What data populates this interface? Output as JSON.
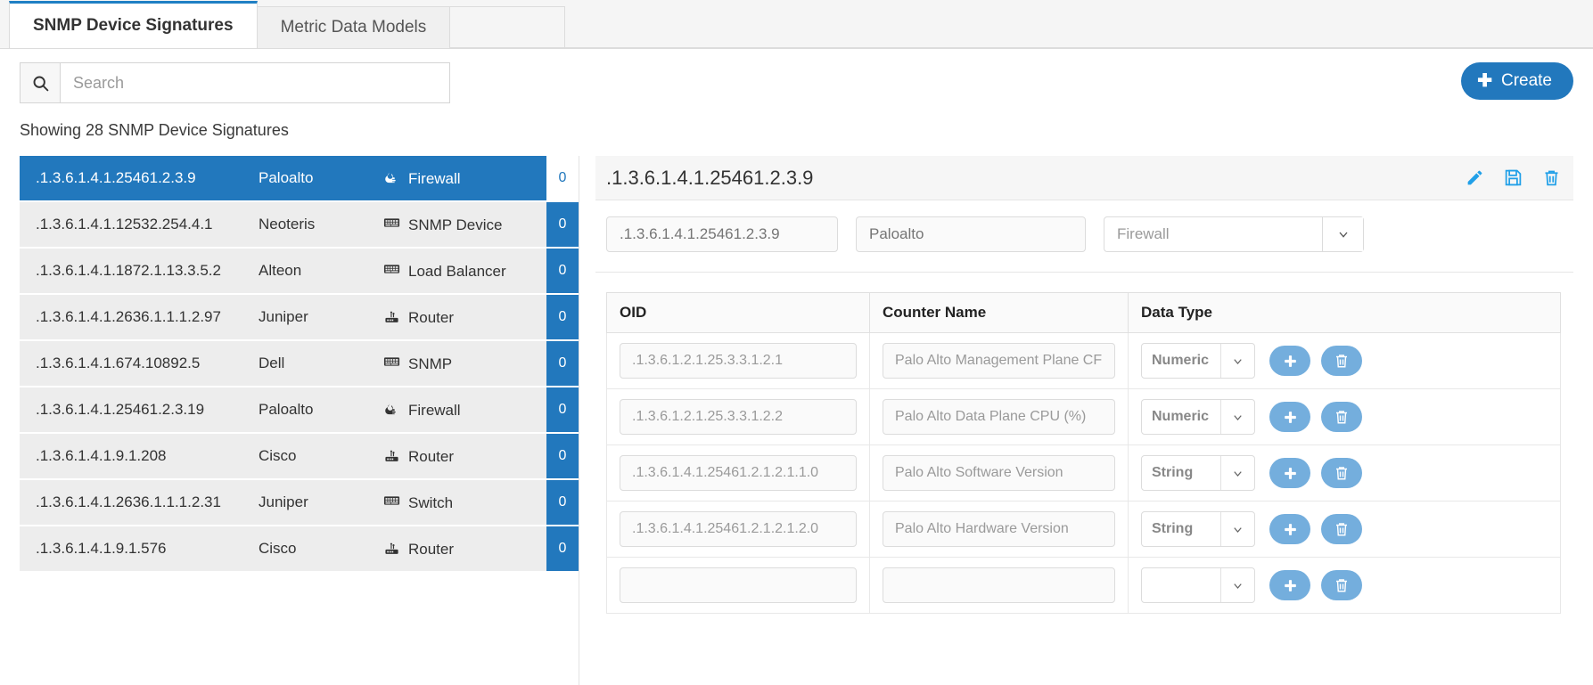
{
  "tabs": [
    {
      "label": "SNMP Device Signatures",
      "active": true
    },
    {
      "label": "Metric Data Models",
      "active": false
    }
  ],
  "search": {
    "placeholder": "Search",
    "value": ""
  },
  "toolbar": {
    "create_label": "Create"
  },
  "status": {
    "showing_text": "Showing 28 SNMP Device Signatures"
  },
  "list": {
    "rows": [
      {
        "oid": ".1.3.6.1.4.1.25461.2.3.9",
        "vendor": "Paloalto",
        "type": "Firewall",
        "icon": "firewall-icon",
        "count": "0",
        "selected": true
      },
      {
        "oid": ".1.3.6.1.4.1.12532.254.4.1",
        "vendor": "Neoteris",
        "type": "SNMP Device",
        "icon": "snmp-device-icon",
        "count": "0",
        "selected": false
      },
      {
        "oid": ".1.3.6.1.4.1.1872.1.13.3.5.2",
        "vendor": "Alteon",
        "type": "Load Balancer",
        "icon": "load-balancer-icon",
        "count": "0",
        "selected": false
      },
      {
        "oid": ".1.3.6.1.4.1.2636.1.1.1.2.97",
        "vendor": "Juniper",
        "type": "Router",
        "icon": "router-icon",
        "count": "0",
        "selected": false
      },
      {
        "oid": ".1.3.6.1.4.1.674.10892.5",
        "vendor": "Dell",
        "type": "SNMP",
        "icon": "snmp-device-icon",
        "count": "0",
        "selected": false
      },
      {
        "oid": ".1.3.6.1.4.1.25461.2.3.19",
        "vendor": "Paloalto",
        "type": "Firewall",
        "icon": "firewall-icon",
        "count": "0",
        "selected": false
      },
      {
        "oid": ".1.3.6.1.4.1.9.1.208",
        "vendor": "Cisco",
        "type": "Router",
        "icon": "router-icon",
        "count": "0",
        "selected": false
      },
      {
        "oid": ".1.3.6.1.4.1.2636.1.1.1.2.31",
        "vendor": "Juniper",
        "type": "Switch",
        "icon": "switch-icon",
        "count": "0",
        "selected": false
      },
      {
        "oid": ".1.3.6.1.4.1.9.1.576",
        "vendor": "Cisco",
        "type": "Router",
        "icon": "router-icon",
        "count": "0",
        "selected": false
      }
    ]
  },
  "detail": {
    "title": ".1.3.6.1.4.1.25461.2.3.9",
    "actions": [
      {
        "name": "edit-icon",
        "title": "Edit"
      },
      {
        "name": "save-icon",
        "title": "Save"
      },
      {
        "name": "delete-icon",
        "title": "Delete"
      }
    ],
    "fields": {
      "oid_placeholder": ".1.3.6.1.4.1.25461.2.3.9",
      "vendor_placeholder": "Paloalto",
      "type_value": "Firewall"
    },
    "table": {
      "headers": [
        "OID",
        "Counter Name",
        "Data Type"
      ],
      "rows": [
        {
          "oid": ".1.3.6.1.2.1.25.3.3.1.2.1",
          "counter": "Palo Alto Management Plane CF",
          "dtype": "Numeric"
        },
        {
          "oid": ".1.3.6.1.2.1.25.3.3.1.2.2",
          "counter": "Palo Alto Data Plane CPU (%)",
          "dtype": "Numeric"
        },
        {
          "oid": ".1.3.6.1.4.1.25461.2.1.2.1.1.0",
          "counter": "Palo Alto Software Version",
          "dtype": "String"
        },
        {
          "oid": ".1.3.6.1.4.1.25461.2.1.2.1.2.0",
          "counter": "Palo Alto Hardware Version",
          "dtype": "String"
        },
        {
          "oid": "",
          "counter": "",
          "dtype": ""
        }
      ],
      "add_label": "+",
      "delete_label": "delete"
    }
  },
  "colors": {
    "accent": "#2278bd",
    "icon_blue": "#21a0e8",
    "pill_blue": "#74aedd",
    "row_bg": "#ededed"
  }
}
